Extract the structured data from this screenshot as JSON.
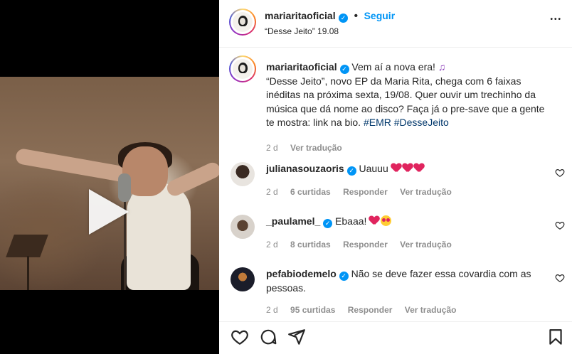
{
  "post": {
    "username": "mariaritaoficial",
    "follow_label": "Seguir",
    "dot": "•",
    "subtitle": "“Desse Jeito” 19.08",
    "more_label": "•••"
  },
  "caption": {
    "username": "mariaritaoficial",
    "line1": "Vem aí a nova era!",
    "emoji": "♫",
    "body": "“Desse Jeito”, novo EP da Maria Rita, chega com 6 faixas inéditas na próxima sexta, 19/08. Quer ouvir um trechinho da música que dá nome ao disco? Faça já o pre-save que a gente te mostra: link na bio.",
    "hashtags": "#EMR #DesseJeito",
    "time": "2 d",
    "translate": "Ver tradução"
  },
  "comments": [
    {
      "username": "julianasouzaoris",
      "text": "Uauuu",
      "time": "2 d",
      "likes": "6 curtidas",
      "reply": "Responder",
      "translate": "Ver tradução"
    },
    {
      "username": "_paulamel_",
      "text": "Ebaaa!",
      "time": "2 d",
      "likes": "8 curtidas",
      "reply": "Responder",
      "translate": "Ver tradução"
    },
    {
      "username": "pefabiodemelo",
      "text": "Não se deve fazer essa covardia com as pessoas.",
      "time": "2 d",
      "likes": "95 curtidas",
      "reply": "Responder",
      "translate": "Ver tradução"
    }
  ],
  "colors": {
    "accent": "#0095f6",
    "text": "#262626",
    "muted": "#8e8e8e",
    "hashtag": "#00376b"
  }
}
